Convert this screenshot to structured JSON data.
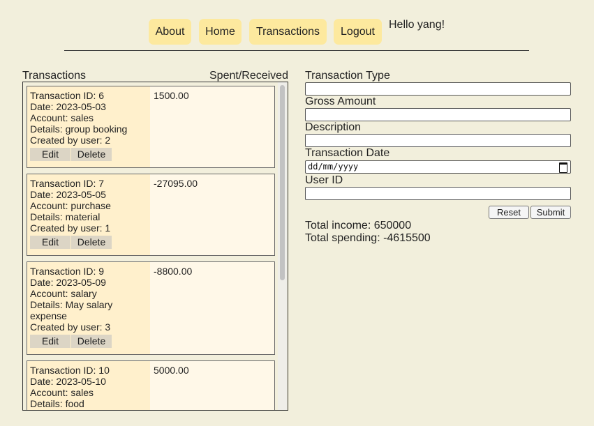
{
  "nav": {
    "about": "About",
    "home": "Home",
    "transactions": "Transactions",
    "logout": "Logout",
    "greeting": "Hello yang!"
  },
  "list": {
    "heading_left": "Transactions",
    "heading_right": "Spent/Received",
    "edit_label": "Edit",
    "delete_label": "Delete",
    "items": [
      {
        "id": "Transaction ID: 6",
        "date": "Date: 2023-05-03",
        "account": "Account: sales",
        "details": "Details: group booking",
        "details2": "",
        "user": "Created by user: 2",
        "amount": "1500.00"
      },
      {
        "id": "Transaction ID: 7",
        "date": "Date: 2023-05-05",
        "account": "Account: purchase",
        "details": "Details: material",
        "details2": "",
        "user": "Created by user: 1",
        "amount": "-27095.00"
      },
      {
        "id": "Transaction ID: 9",
        "date": "Date: 2023-05-09",
        "account": "Account: salary",
        "details": "Details: May salary",
        "details2": "expense",
        "user": "Created by user: 3",
        "amount": "-8800.00"
      },
      {
        "id": "Transaction ID: 10",
        "date": "Date: 2023-05-10",
        "account": "Account: sales",
        "details": "Details: food",
        "details2": "",
        "user": "",
        "amount": "5000.00"
      }
    ]
  },
  "form": {
    "type_label": "Transaction Type",
    "amount_label": "Gross Amount",
    "description_label": "Description",
    "date_label": "Transaction Date",
    "date_placeholder": "dd/mm/yyyy",
    "user_label": "User ID",
    "reset_label": "Reset",
    "submit_label": "Submit"
  },
  "totals": {
    "income": "Total income: 650000",
    "spending": "Total spending: -4615500"
  }
}
